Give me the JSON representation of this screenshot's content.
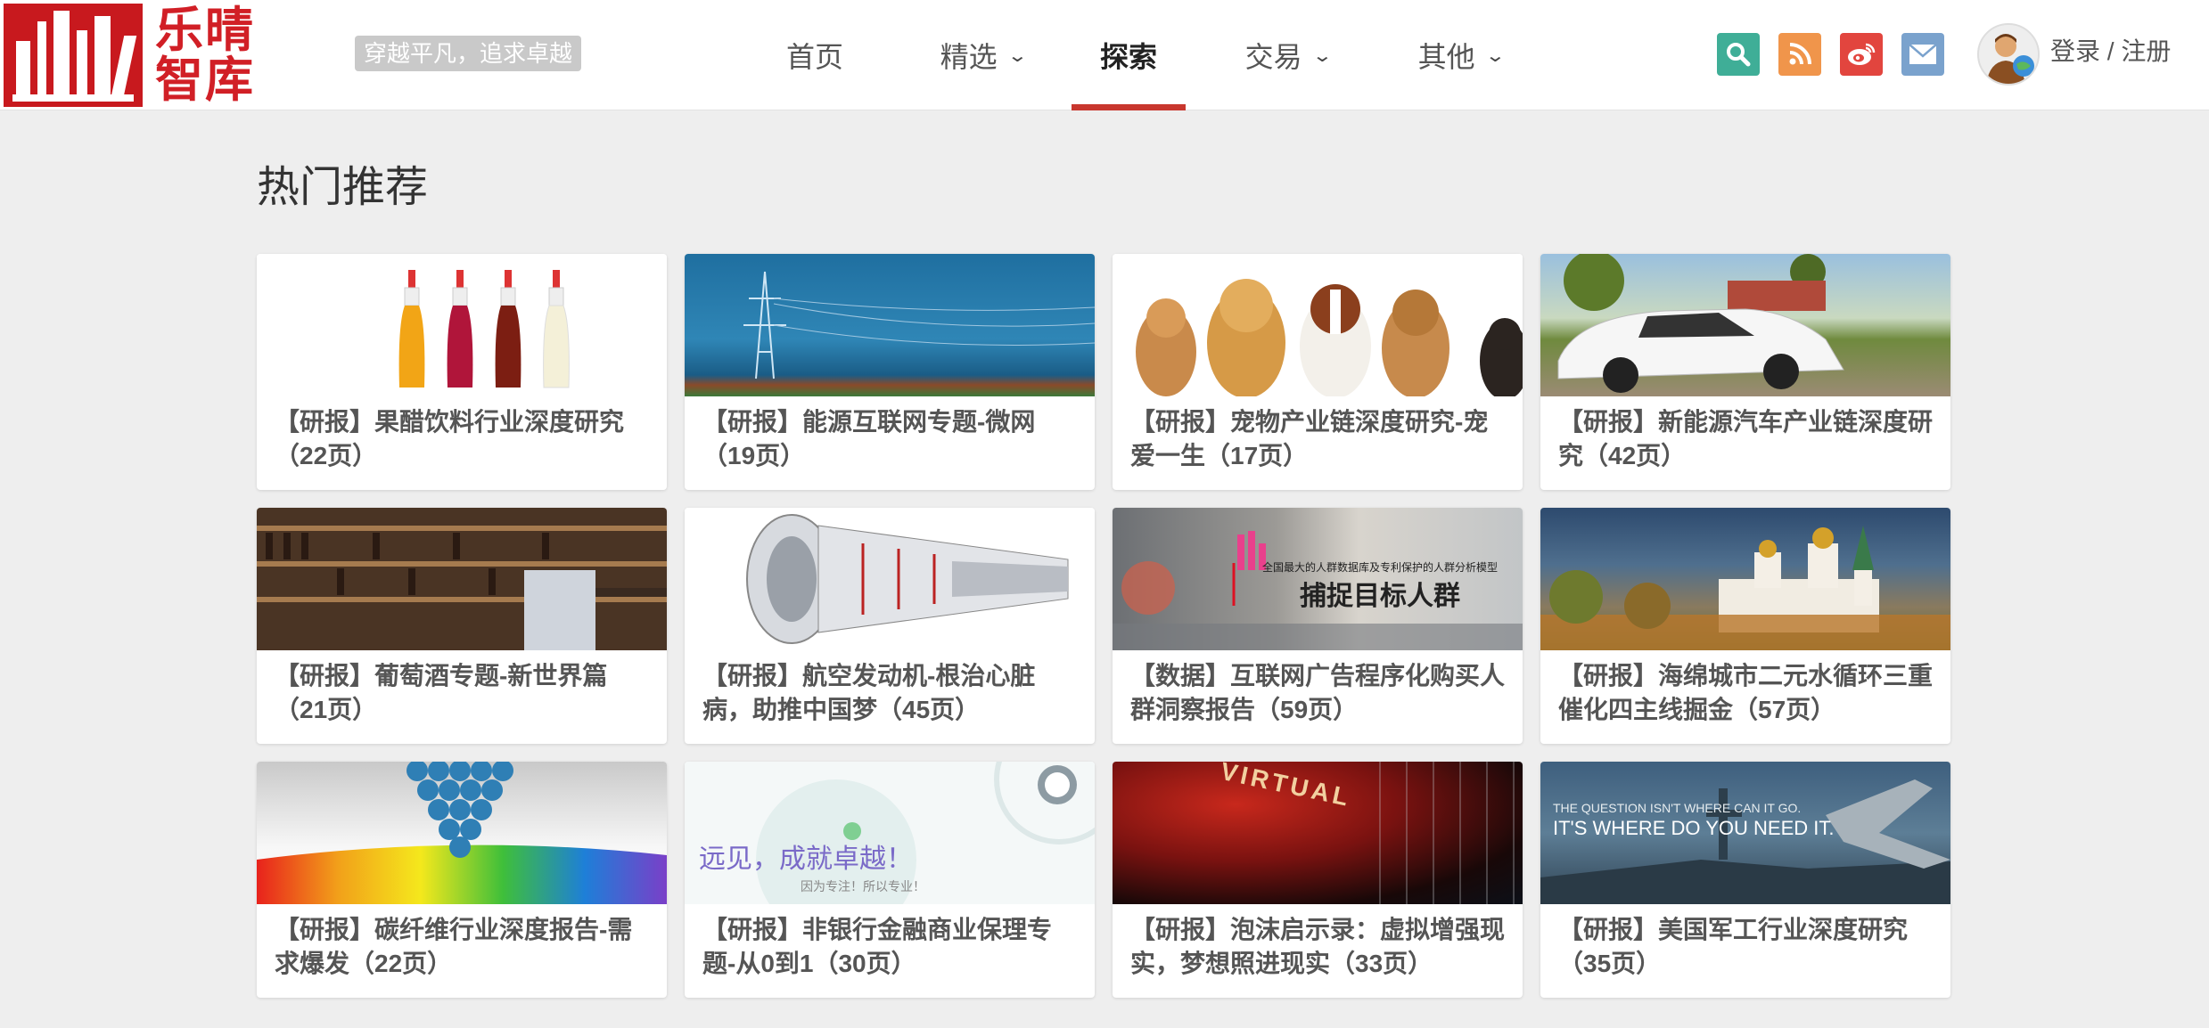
{
  "header": {
    "logo_text": [
      "乐晴",
      "智库"
    ],
    "slogan": "穿越平凡，追求卓越",
    "nav": [
      {
        "label": "首页",
        "dropdown": false,
        "active": false
      },
      {
        "label": "精选",
        "dropdown": true,
        "active": false
      },
      {
        "label": "探索",
        "dropdown": false,
        "active": true
      },
      {
        "label": "交易",
        "dropdown": true,
        "active": false
      },
      {
        "label": "其他",
        "dropdown": true,
        "active": false
      }
    ],
    "icons": [
      {
        "name": "search-icon",
        "color": "#3fae97"
      },
      {
        "name": "rss-icon",
        "color": "#f0954b"
      },
      {
        "name": "weibo-icon",
        "color": "#e2453e"
      },
      {
        "name": "mail-icon",
        "color": "#7aa2cd"
      }
    ],
    "login": "登录",
    "separator": " / ",
    "register": "注册"
  },
  "main": {
    "section_title": "热门推荐",
    "cards": [
      {
        "title": "【研报】果醋饮料行业深度研究（22页）",
        "image": "juice-bottles-image"
      },
      {
        "title": "【研报】能源互联网专题-微网（19页）",
        "image": "power-tower-image"
      },
      {
        "title": "【研报】宠物产业链深度研究-宠爱一生（17页）",
        "image": "puppies-image"
      },
      {
        "title": "【研报】新能源汽车产业链深度研究（42页）",
        "image": "sports-car-image"
      },
      {
        "title": "【研报】葡萄酒专题-新世界篇（21页）",
        "image": "wine-shop-image"
      },
      {
        "title": "【研报】航空发动机-根治心脏病，助推中国梦（45页）",
        "image": "jet-engine-image"
      },
      {
        "title": "【数据】互联网广告程序化购买人群洞察报告（59页）",
        "image": "ad-banner-image",
        "banner_small": "全国最大的人群数据库及专利保护的人群分析模型",
        "banner_big": "捕捉目标人群"
      },
      {
        "title": "【研报】海绵城市二元水循环三重催化四主线掘金（57页）",
        "image": "monastery-image"
      },
      {
        "title": "【研报】碳纤维行业深度报告-需求爆发（22页）",
        "image": "carbon-molecule-image"
      },
      {
        "title": "【研报】非银行金融商业保理专题-从0到1（30页）",
        "image": "finance-banner-image",
        "banner_big": "远见，成就卓越！",
        "banner_small": "因为专注！所以专业！"
      },
      {
        "title": "【研报】泡沫启示录：虚拟增强现实，梦想照进现实（33页）",
        "image": "virtual-reality-image",
        "banner_big": "VIRTUAL"
      },
      {
        "title": "【研报】美国军工行业深度研究（35页）",
        "image": "military-jet-image",
        "banner_small": "THE QUESTION ISN'T WHERE CAN IT GO.",
        "banner_big": "IT'S WHERE DO YOU NEED IT."
      }
    ]
  }
}
